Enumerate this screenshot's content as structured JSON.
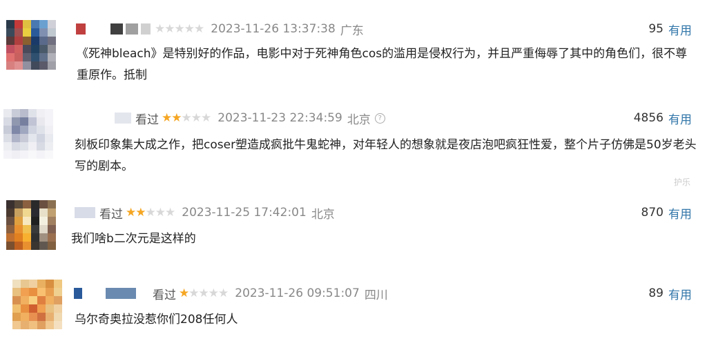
{
  "comments": [
    {
      "viewed": "",
      "stars_on": 0,
      "stars_total": 5,
      "time": "2023-11-26 13:37:38",
      "location": "广东",
      "has_info_icon": false,
      "votes": "95",
      "useful": "有用",
      "text": "《死神bleach》是特别好的作品，电影中对于死神角色cos的滥用是侵权行为，并且严重侮辱了其中的角色们，很不尊重原作。抵制",
      "avatar_colors": [
        "#2a3a4a",
        "#c23a3a",
        "#e0c040",
        "#4a78b0",
        "#6aa0d0",
        "#d0d0d8",
        "#3a4a5a",
        "#a05050",
        "#e8d040",
        "#2a5a9a",
        "#8090b0",
        "#c0c8d0",
        "#5a3a3a",
        "#b04040",
        "#8a6030",
        "#1a3a6a",
        "#5a6a8a",
        "#707080",
        "#c05060",
        "#d06060",
        "#4a4a5a",
        "#204060",
        "#4a5a6a",
        "#909098",
        "#e07070",
        "#c86060",
        "#606070",
        "#305070",
        "#60708a",
        "#b0b0b8",
        "#d88080",
        "#e09090",
        "#9090a0",
        "#404a5a",
        "#5a5a6a",
        "#a0a0a8"
      ]
    },
    {
      "viewed": "看过",
      "stars_on": 2,
      "stars_total": 5,
      "time": "2023-11-23 22:34:59",
      "location": "北京",
      "has_info_icon": true,
      "votes": "4856",
      "useful": "有用",
      "text": "刻板印象集大成之作，把coser塑造成疯批牛鬼蛇神，对年轻人的想象就是夜店泡吧疯狂性爱，整个片子仿佛是50岁老头写的剧本。",
      "partial_text": "护乐",
      "avatar_colors": [
        "#e8eaf0",
        "#c8ccd8",
        "#b8bccc",
        "#e0e2ea",
        "#f0f0f4",
        "#f4f4f8",
        "#d8dae4",
        "#9098b0",
        "#7880a0",
        "#c0c4d4",
        "#e8e8ee",
        "#f4f4f8",
        "#c8ccd8",
        "#8088a8",
        "#a0a8c0",
        "#d0d4e0",
        "#e0e2ea",
        "#f0f0f4",
        "#dcdee6",
        "#b0b4c8",
        "#c8cad8",
        "#e4e6ee",
        "#d0d4e0",
        "#e8eaf0",
        "#eceef2",
        "#d8dae4",
        "#e0e2ea",
        "#f0f0f4",
        "#d8dae4",
        "#eceef2",
        "#f4f4f8",
        "#f0f0f4",
        "#f4f4f8",
        "#f8f8fa",
        "#f4f4f8",
        "#f8f8fa"
      ]
    },
    {
      "viewed": "看过",
      "stars_on": 2,
      "stars_total": 5,
      "time": "2023-11-25 17:42:01",
      "location": "北京",
      "has_info_icon": false,
      "votes": "870",
      "useful": "有用",
      "text": "我们啥b二次元是这样的",
      "avatar_colors": [
        "#3a3030",
        "#5a4a3a",
        "#8a6040",
        "#2a2a2a",
        "#6a5040",
        "#8a7050",
        "#4a3a30",
        "#c8a060",
        "#f0d890",
        "#2a2a30",
        "#e8e0c8",
        "#c0a070",
        "#6a5040",
        "#e0a040",
        "#f8e8c0",
        "#202020",
        "#f4f0e0",
        "#a08060",
        "#8a6040",
        "#e89030",
        "#f0c050",
        "#3a3a3a",
        "#e0d8c8",
        "#806050",
        "#c07030",
        "#e08020",
        "#f8b030",
        "#303030",
        "#a09080",
        "#9a7050",
        "#7a5030",
        "#c06020",
        "#e89030",
        "#3a3530",
        "#605850",
        "#806040"
      ]
    },
    {
      "viewed": "看过",
      "stars_on": 1,
      "stars_total": 5,
      "time": "2023-11-26 09:51:07",
      "location": "四川",
      "has_info_icon": false,
      "votes": "89",
      "useful": "有用",
      "text": "乌尔奇奥拉没惹你们208任何人",
      "avatar_colors": [
        "#f0e0c0",
        "#e8c890",
        "#f0d0a0",
        "#e8b060",
        "#d89040",
        "#f0c880",
        "#e8c080",
        "#f0a050",
        "#e89040",
        "#f8c070",
        "#e8a050",
        "#f0d090",
        "#d89050",
        "#f0b060",
        "#f8d080",
        "#e08040",
        "#f0b060",
        "#e0a060",
        "#f0c070",
        "#e89040",
        "#d06030",
        "#f0a050",
        "#e8c080",
        "#f0d0a0",
        "#e0a050",
        "#f0b060",
        "#e89050",
        "#d07040",
        "#e8b070",
        "#f0d8b0",
        "#f0c890",
        "#e8b070",
        "#f0c080",
        "#e0a060",
        "#f0c890",
        "#f4e0c0"
      ]
    }
  ]
}
